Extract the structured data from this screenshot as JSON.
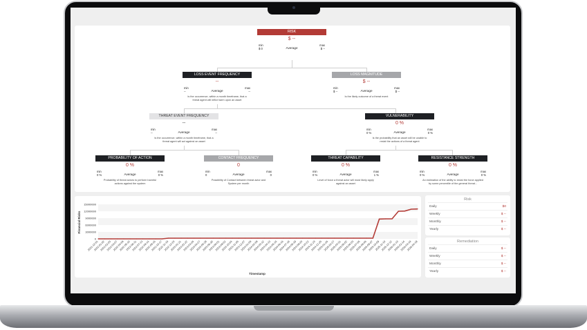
{
  "colors": {
    "accent": "#b33b36",
    "dark_header": "#1e2024",
    "gray_header": "#a6a7aa"
  },
  "tree": {
    "risk": {
      "title": "RISK",
      "value": "$ --",
      "min_label": "min",
      "min_value": "$ 0",
      "avg": "Average",
      "max_label": "max",
      "max_value": "$ --"
    },
    "lef": {
      "title": "LOSS EVENT FREQUENCY",
      "value": "--",
      "min_label": "min",
      "min_value": "--",
      "avg": "Average",
      "max_label": "max",
      "max_value": "--",
      "desc": "Is the occurrence, within a month timeframe, that a threat agent will inflict harm upon an asset"
    },
    "lm": {
      "title": "LOSS MAGNITUDE",
      "value": "$ --",
      "min_label": "min",
      "min_value": "$ --",
      "avg": "Average",
      "max_label": "max",
      "max_value": "$ --",
      "desc": "Is the likely outcome of a threat event"
    },
    "tef": {
      "title": "THREAT EVENT FREQUENCY",
      "value": "--",
      "min_label": "min",
      "min_value": "--",
      "avg": "Average",
      "max_label": "max",
      "max_value": "--",
      "desc": "Is the occurrence, within a month timeframe, that a threat agent will act against an asset"
    },
    "vuln": {
      "title": "VULNERABILITY",
      "value": "0 %",
      "min_label": "min",
      "min_value": "0 %",
      "avg": "Average",
      "max_label": "max",
      "max_value": "0 %",
      "desc": "Is the probability that an asset will be unable to resist the actions of a threat agent"
    },
    "poa": {
      "title": "PROBABILITY OF ACTION",
      "value": "0 %",
      "min_label": "min",
      "min_value": "0 %",
      "avg": "Average",
      "max_label": "max",
      "max_value": "0 %",
      "desc": "Probability of threat actors to perform harmful actions against the system"
    },
    "cf": {
      "title": "CONTACT FREQUENCY",
      "value": "0",
      "min_label": "min",
      "min_value": "0",
      "avg": "Average",
      "max_label": "max",
      "max_value": "0",
      "desc": "Possibility of Contact between threat actor and System per month"
    },
    "tc": {
      "title": "THREAT CAPABILITY",
      "value": "0 %",
      "min_label": "min",
      "min_value": "0 %",
      "avg": "Average",
      "max_label": "max",
      "max_value": "1 %",
      "desc": "Level of force a threat actor will most likely apply against an asset"
    },
    "rs": {
      "title": "RESISTANCE STRENGTH",
      "value": "0 %",
      "min_label": "min",
      "min_value": "0 %",
      "avg": "Average",
      "max_label": "max",
      "max_value": "0 %",
      "desc": "An estimation of the ability to resist the force applied by some percentile of the general threat..."
    }
  },
  "risk_panel": {
    "title": "Risk",
    "rows": [
      {
        "label": "Daily",
        "value": "$0"
      },
      {
        "label": "Weekly",
        "value": "$ --"
      },
      {
        "label": "Monthly",
        "value": "$ --"
      },
      {
        "label": "Yearly",
        "value": "$ --"
      }
    ]
  },
  "remediation_panel": {
    "title": "Remediation",
    "rows": [
      {
        "label": "Daily",
        "value": "$ --"
      },
      {
        "label": "Weekly",
        "value": "$ --"
      },
      {
        "label": "Monthly",
        "value": "$ --"
      },
      {
        "label": "Yearly",
        "value": "$ --"
      }
    ]
  },
  "chart_data": {
    "type": "line",
    "xlabel": "Timestamp",
    "ylabel": "Financial Risks",
    "ylim": [
      0,
      15000000
    ],
    "yticks": [
      0,
      3000000,
      6000000,
      9000000,
      12000000,
      15000000
    ],
    "grid": true,
    "x": [
      "2021-12-01",
      "2022-01-02",
      "2022-02-03",
      "2022-03-07",
      "2022-04-08",
      "2022-05-10",
      "2022-06-11",
      "2022-07-13",
      "2022-08-14",
      "2022-09-15",
      "2022-10-17",
      "2022-11-18",
      "2022-12-20",
      "2023-01-21",
      "2023-02-22",
      "2023-03-26",
      "2023-04-27",
      "2023-05-29",
      "2023-06-30",
      "2023-08-01",
      "2023-09-02",
      "2023-10-04",
      "2023-11-05",
      "2023-12-07",
      "2024-01-08",
      "2024-02-09",
      "2024-03-12",
      "2024-04-13",
      "2024-05-15",
      "2024-06-16",
      "2024-07-18",
      "2024-08-19",
      "2024-09-20",
      "2024-10-22",
      "2024-11-23",
      "2024-12-25",
      "2025-01-26",
      "2025-02-27",
      "2025-03-31",
      "2025-05-02",
      "2025-06-03",
      "2025-07-05",
      "2025-08-06",
      "2025-09-07",
      "2025-10-09",
      "2025-11-10",
      "2025-12-12",
      "2026-01-13",
      "2026-02-14",
      "2026-03-18",
      "2026-04-19"
    ],
    "y": [
      0,
      0,
      0,
      0,
      0,
      0,
      0,
      0,
      0,
      0,
      0,
      300000,
      300000,
      300000,
      300000,
      300000,
      300000,
      300000,
      300000,
      300000,
      300000,
      300000,
      300000,
      300000,
      300000,
      300000,
      300000,
      300000,
      300000,
      300000,
      300000,
      300000,
      300000,
      300000,
      300000,
      300000,
      300000,
      300000,
      300000,
      300000,
      300000,
      300000,
      300000,
      300000,
      8600000,
      8700000,
      8700000,
      12000000,
      12100000,
      12900000,
      13000000
    ]
  }
}
